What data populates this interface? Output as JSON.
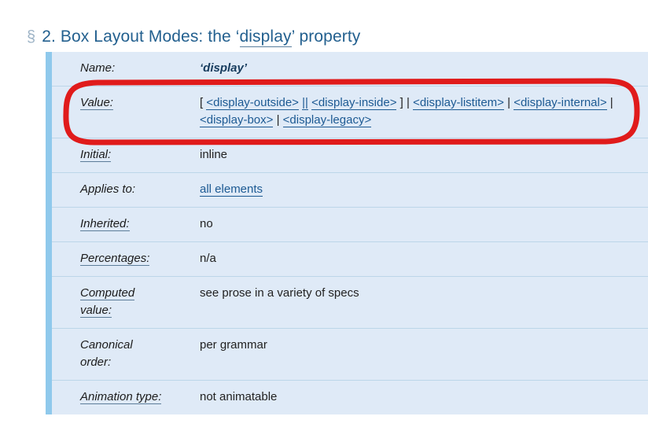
{
  "heading": {
    "section_mark": "§",
    "number": "2.",
    "text_before": "Box Layout Modes: the ",
    "open_quote": "‘",
    "property_link": "display",
    "close_quote": "’",
    "text_after": " property",
    "full_text": "§ 2. Box Layout Modes: the ‘display’ property",
    "color": "#23608f",
    "section_mark_color": "#9db3c6"
  },
  "propdef": {
    "left_stripe_color": "#8fc9ec",
    "background_color": "#dfeaf7",
    "row_divider_color": "#bcd6e9",
    "link_color": "#1d5a93",
    "rows": [
      {
        "label": "Name:",
        "label_is_link": false,
        "value_kind": "property-name",
        "value": "‘display’"
      },
      {
        "label": "Value:",
        "label_is_link": true,
        "value_kind": "grammar",
        "value": "[ <display-outside> || <display-inside> ] | <display-listitem> | <display-internal> | <display-box> | <display-legacy>",
        "tokens": [
          {
            "text": "[",
            "link": false
          },
          {
            "text": "<display-outside>",
            "link": true
          },
          {
            "text": "||",
            "link": true
          },
          {
            "text": "<display-inside>",
            "link": true
          },
          {
            "text": "]",
            "link": false
          },
          {
            "text": "|",
            "link": false
          },
          {
            "text": "<display-listitem>",
            "link": true
          },
          {
            "text": "|",
            "link": false
          },
          {
            "text": "<display-internal>",
            "link": true
          },
          {
            "text": "|",
            "link": false
          },
          {
            "text": "<display-box>",
            "link": true
          },
          {
            "text": "|",
            "link": false
          },
          {
            "text": "<display-legacy>",
            "link": true
          }
        ]
      },
      {
        "label": "Initial:",
        "label_is_link": true,
        "value_kind": "plain",
        "value": "inline"
      },
      {
        "label": "Applies to:",
        "label_is_link": false,
        "value_kind": "link",
        "value": "all elements"
      },
      {
        "label": "Inherited:",
        "label_is_link": true,
        "value_kind": "plain",
        "value": "no"
      },
      {
        "label": "Percentages:",
        "label_is_link": true,
        "value_kind": "plain",
        "value": "n/a"
      },
      {
        "label": "Computed value:",
        "label_is_link": true,
        "value_kind": "plain",
        "value": "see prose in a variety of specs"
      },
      {
        "label": "Canonical order:",
        "label_is_link": false,
        "value_kind": "plain",
        "value": "per grammar"
      },
      {
        "label": "Animation type:",
        "label_is_link": true,
        "value_kind": "plain",
        "value": "not animatable"
      }
    ]
  },
  "annotation": {
    "shape": "rounded-rectangle",
    "color": "#e01b1b",
    "stroke_width": 7,
    "targets_row_label": "Value:"
  }
}
